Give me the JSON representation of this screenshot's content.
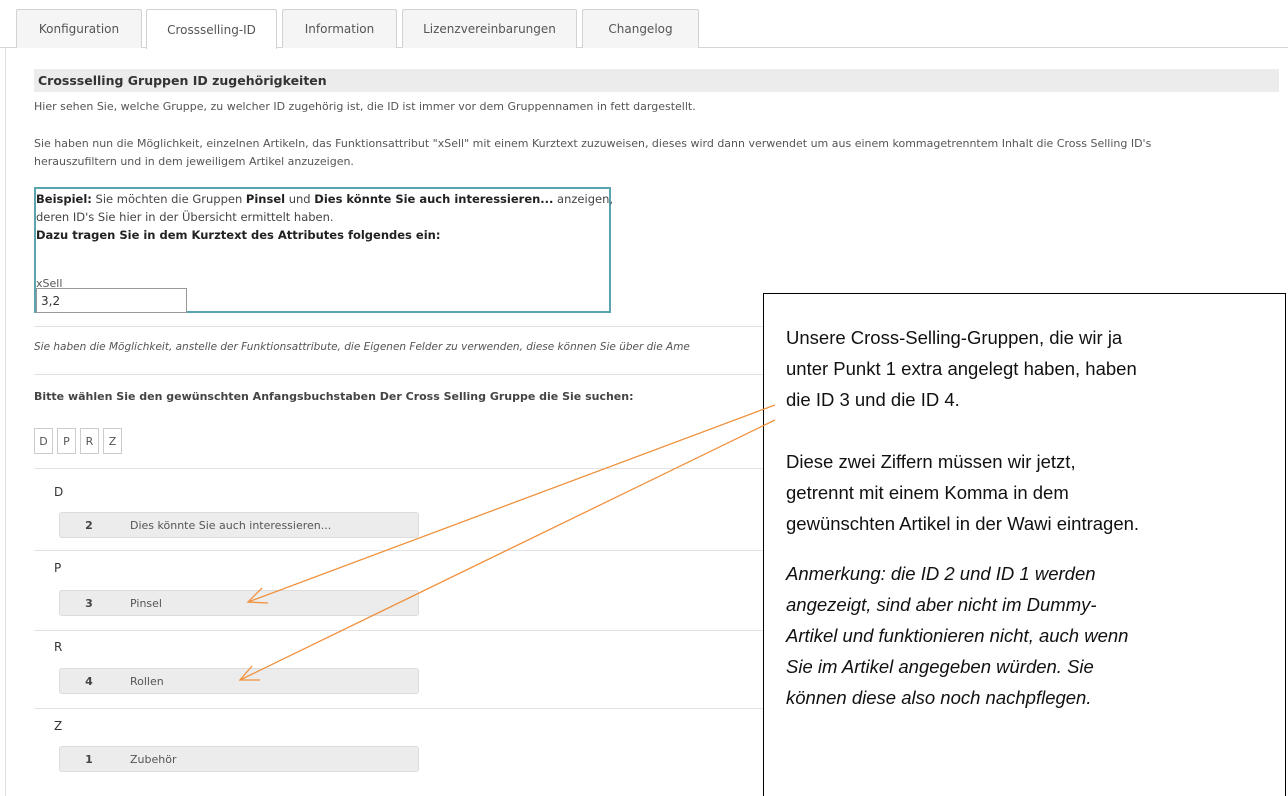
{
  "tabs": [
    {
      "label": "Konfiguration"
    },
    {
      "label": "Crossselling-ID"
    },
    {
      "label": "Information"
    },
    {
      "label": "Lizenzvereinbarungen"
    },
    {
      "label": "Changelog"
    }
  ],
  "section": {
    "title": "Crossselling Gruppen ID zugehörigkeiten",
    "intro": "Hier sehen Sie, welche Gruppe, zu welcher ID zugehörig ist, die ID ist immer vor dem Gruppennamen in fett dargestellt.",
    "desc_line1": "Sie haben nun die Möglichkeit, einzelnen Artikeln, das Funktionsattribut \"xSell\" mit einem Kurztext zuzuweisen, dieses wird dann verwendet um aus einem kommagetrenntem Inhalt die Cross Selling ID's",
    "desc_line2": "herauszufiltern und in dem jeweiligem Artikel anzuzeigen."
  },
  "example": {
    "label_bold": "Beispiel:",
    "text_a": " Sie möchten die Gruppen ",
    "group1": "Pinsel",
    "text_b": " und ",
    "group2": "Dies könnte Sie auch interessieren...",
    "text_c": " anzeigen,",
    "line2": "deren ID's Sie hier in der Übersicht ermittelt haben.",
    "line3": "Dazu tragen Sie in dem Kurztext des Attributes folgendes ein:",
    "field_label": "xSell",
    "field_value": "3,2"
  },
  "note": "Sie haben die Möglichkeit, anstelle der Funktionsattribute, die Eigenen Felder zu verwenden, diese können Sie über die Ame",
  "choose_label": "Bitte wählen Sie den gewünschten Anfangsbuchstaben Der Cross Selling Gruppe die Sie suchen:",
  "letters": [
    "D",
    "P",
    "R",
    "Z"
  ],
  "groups": [
    {
      "letter": "D",
      "id": "2",
      "name": "Dies könnte Sie auch interessieren..."
    },
    {
      "letter": "P",
      "id": "3",
      "name": "Pinsel"
    },
    {
      "letter": "R",
      "id": "4",
      "name": "Rollen"
    },
    {
      "letter": "Z",
      "id": "1",
      "name": "Zubehör"
    }
  ],
  "callout": {
    "p1_l1": "Unsere Cross-Selling-Gruppen, die wir ja",
    "p1_l2": "unter Punkt 1 extra angelegt haben, haben",
    "p1_l3": "die ID 3 und die ID 4.",
    "p2_l1": "Diese zwei Ziffern müssen wir jetzt,",
    "p2_l2": "getrennt mit einem Komma in dem",
    "p2_l3": "gewünschten Artikel in der Wawi eintragen.",
    "p3_l1": "Anmerkung: die ID 2 und ID 1 werden",
    "p3_l2": "angezeigt, sind aber nicht im Dummy-",
    "p3_l3": "Artikel und funktionieren nicht, auch wenn",
    "p3_l4": "Sie im Artikel angegeben würden. Sie",
    "p3_l5": "können diese also noch nachpflegen."
  },
  "colors": {
    "accent_border": "#5aa4ad",
    "arrow": "#f0913e"
  }
}
